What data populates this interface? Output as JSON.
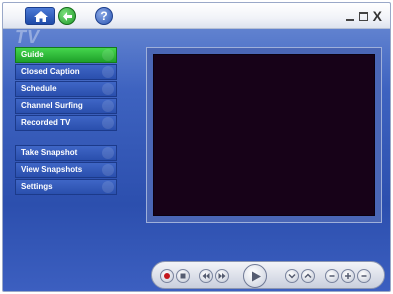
{
  "watermark": "TV",
  "titlebar": {
    "home_icon": "home-icon",
    "back_icon": "back-arrow-icon",
    "help_label": "?",
    "close_label": "X"
  },
  "menu": {
    "primary": [
      {
        "label": "Guide",
        "active": true
      },
      {
        "label": "Closed Caption",
        "active": false
      },
      {
        "label": "Schedule",
        "active": false
      },
      {
        "label": "Channel Surfing",
        "active": false
      },
      {
        "label": "Recorded TV",
        "active": false
      }
    ],
    "secondary": [
      {
        "label": "Take Snapshot",
        "active": false
      },
      {
        "label": "View Snapshots",
        "active": false
      },
      {
        "label": "Settings",
        "active": false
      }
    ]
  },
  "colors": {
    "accent_active": "#2fb83a",
    "menu_blue": "#2f56b4",
    "video_bg": "#170218"
  },
  "transport": {
    "buttons": [
      "record-icon",
      "stop-icon",
      "rewind-icon",
      "fast-forward-icon",
      "play-icon",
      "channel-down-icon",
      "channel-up-icon",
      "mute-icon",
      "volume-up-icon",
      "volume-down-icon"
    ]
  }
}
